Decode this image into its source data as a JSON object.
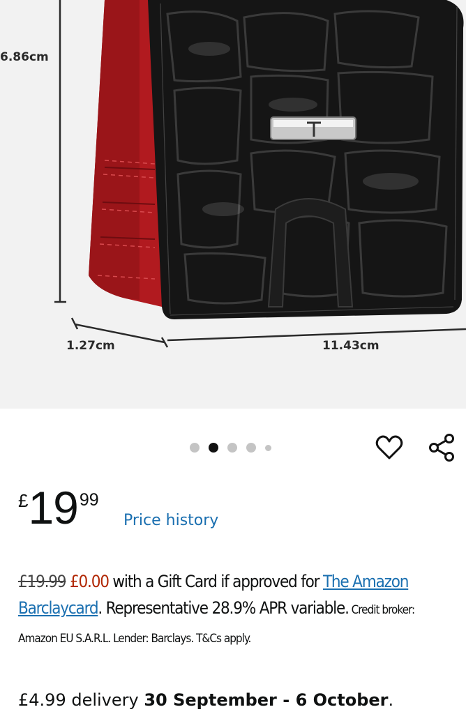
{
  "image": {
    "dim_height": "6.86cm",
    "dim_depth": "1.27cm",
    "dim_width": "11.43cm"
  },
  "carousel": {
    "total": 5,
    "active_index": 1
  },
  "actions": {
    "wishlist_icon": "heart-icon",
    "share_icon": "share-icon"
  },
  "price": {
    "currency": "£",
    "whole": "19",
    "fraction": "99",
    "history_label": "Price history"
  },
  "offer": {
    "old_price": "£19.99",
    "new_price": "£0.00",
    "text_1": " with a Gift Card if approved for ",
    "link": "The Amazon Barclaycard",
    "text_2": ". Representative 28.9% APR variable.",
    "small": " Credit broker: Amazon EU S.A.R.L. Lender: Barclays. T&Cs apply."
  },
  "delivery": {
    "prefix": "£4.99 delivery ",
    "dates": "30 September - 6 October",
    "suffix": "."
  },
  "colors": {
    "link": "#1a6fb0",
    "price_red": "#b12704",
    "wallet_red": "#b11a1f",
    "leather": "#141414"
  }
}
